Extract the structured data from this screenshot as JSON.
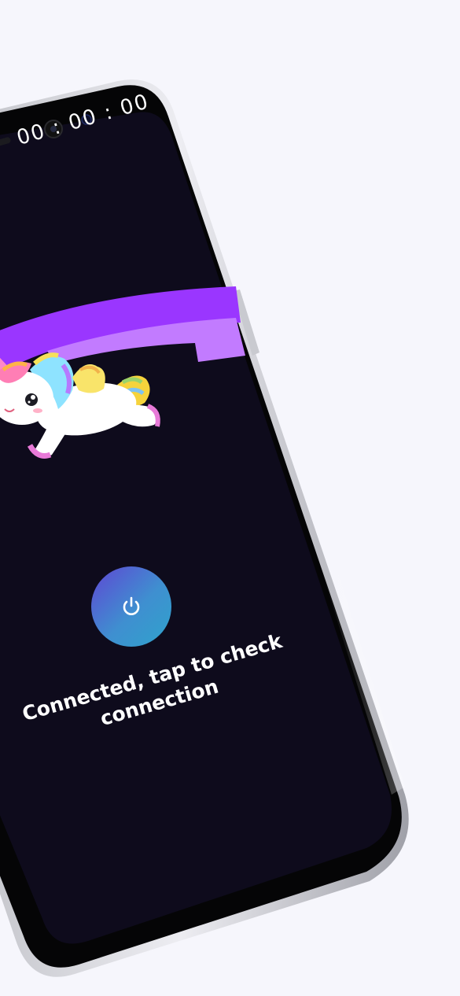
{
  "screen": {
    "timer": "00 : 00 : 00",
    "status_text": "Connected, tap to check connection"
  },
  "icons": {
    "power": "power-icon",
    "mascot": "unicorn-icon",
    "rainbow": "rainbow-icon"
  },
  "colors": {
    "page_background": "#f6f6fc",
    "screen_background": "#0e0b1c",
    "rainbow_primary": "#9a36ff",
    "rainbow_secondary": "#c27bff",
    "button_gradient_start": "#5f46d4",
    "button_gradient_end": "#2fa3cc"
  }
}
